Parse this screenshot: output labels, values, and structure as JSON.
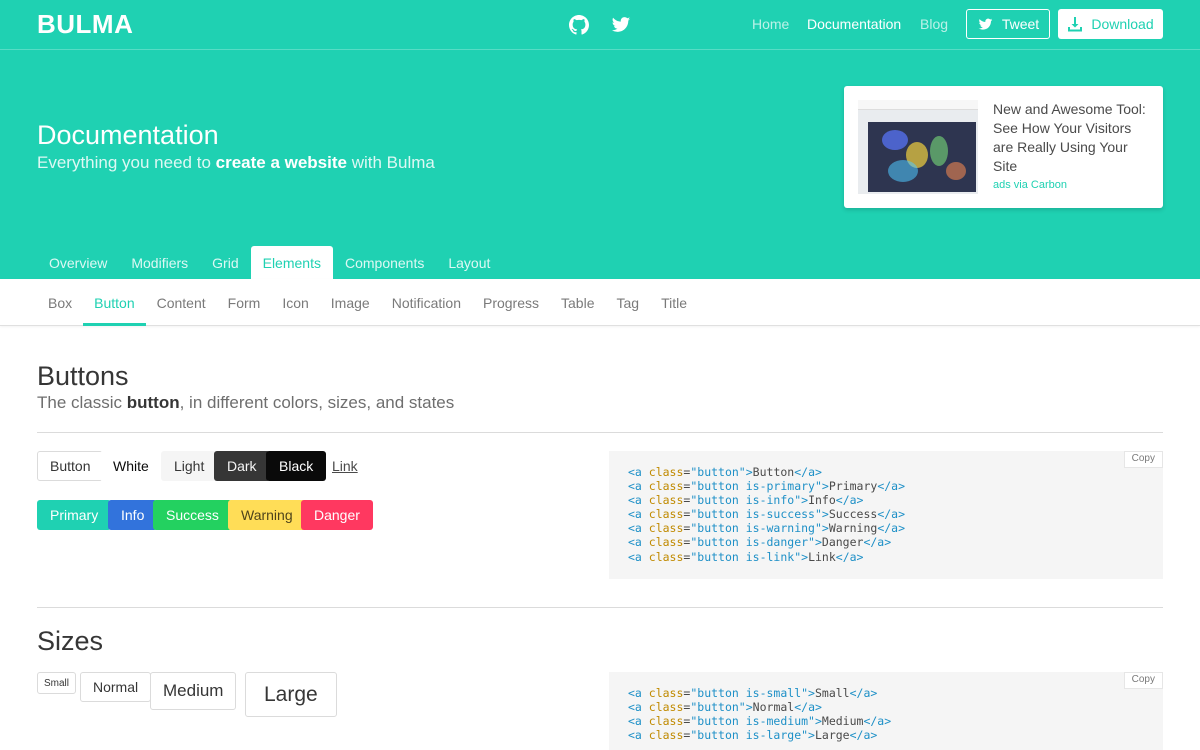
{
  "brand": "BULMA",
  "topnav": {
    "links": [
      "Home",
      "Documentation",
      "Blog"
    ],
    "active": "Documentation",
    "tweet_label": "Tweet",
    "download_label": "Download"
  },
  "hero": {
    "title": "Documentation",
    "subtitle_pre": "Everything you need to ",
    "subtitle_bold": "create a website",
    "subtitle_post": " with Bulma"
  },
  "ad": {
    "text": "New and Awesome Tool: See How Your Visitors are Really Using Your Site",
    "via": "ads via Carbon"
  },
  "tabs": [
    "Overview",
    "Modifiers",
    "Grid",
    "Elements",
    "Components",
    "Layout"
  ],
  "tabs_active": "Elements",
  "subnav": [
    "Box",
    "Button",
    "Content",
    "Form",
    "Icon",
    "Image",
    "Notification",
    "Progress",
    "Table",
    "Tag",
    "Title"
  ],
  "subnav_active": "Button",
  "buttons_section": {
    "title": "Buttons",
    "subtitle_pre": "The classic ",
    "subtitle_bold": "button",
    "subtitle_post": ", in different colors, sizes, and states",
    "row1": [
      "Button",
      "White",
      "Light",
      "Dark",
      "Black",
      "Link"
    ],
    "row2": [
      "Primary",
      "Info",
      "Success",
      "Warning",
      "Danger"
    ],
    "copy_label": "Copy",
    "code": [
      {
        "cls": "button",
        "text": "Button"
      },
      {
        "cls": "button is-primary",
        "text": "Primary"
      },
      {
        "cls": "button is-info",
        "text": "Info"
      },
      {
        "cls": "button is-success",
        "text": "Success"
      },
      {
        "cls": "button is-warning",
        "text": "Warning"
      },
      {
        "cls": "button is-danger",
        "text": "Danger"
      },
      {
        "cls": "button is-link",
        "text": "Link"
      }
    ]
  },
  "sizes_section": {
    "title": "Sizes",
    "buttons": [
      "Small",
      "Normal",
      "Medium",
      "Large"
    ],
    "copy_label": "Copy",
    "code": [
      {
        "cls": "button is-small",
        "text": "Small"
      },
      {
        "cls": "button",
        "text": "Normal"
      },
      {
        "cls": "button is-medium",
        "text": "Medium"
      },
      {
        "cls": "button is-large",
        "text": "Large"
      }
    ]
  },
  "colors": {
    "primary": "#1fd1b2",
    "info": "#3273dc",
    "success": "#23d160",
    "warning": "#ffdd57",
    "danger": "#ff3860",
    "dark": "#363636",
    "black": "#0a0a0a"
  }
}
